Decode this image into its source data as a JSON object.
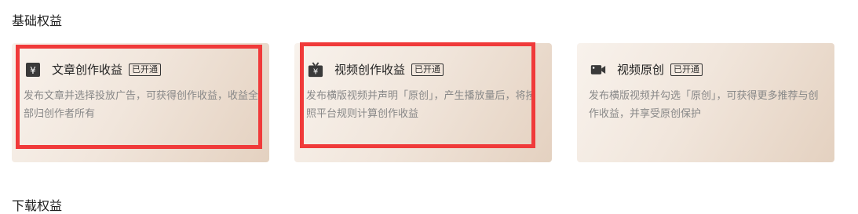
{
  "section": {
    "title": "基础权益",
    "next_title": "下载权益"
  },
  "cards": [
    {
      "icon": "yen-icon",
      "title": "文章创作收益",
      "badge": "已开通",
      "description": "发布文章并选择投放广告，可获得创作收益，收益全部归创作者所有"
    },
    {
      "icon": "tv-yen-icon",
      "title": "视频创作收益",
      "badge": "已开通",
      "description": "发布横版视频并声明「原创」，产生播放量后，将按照平台规则计算创作收益"
    },
    {
      "icon": "video-camera-icon",
      "title": "视频原创",
      "badge": "已开通",
      "description": "发布横版视频并勾选「原创」，可获得更多推荐与创作收益，并享受原创保护"
    }
  ],
  "colors": {
    "highlight": "#f03a3a",
    "card_gradient_start": "#f8f2ec",
    "card_gradient_end": "#e4d1c0",
    "icon": "#3a3a3a"
  }
}
